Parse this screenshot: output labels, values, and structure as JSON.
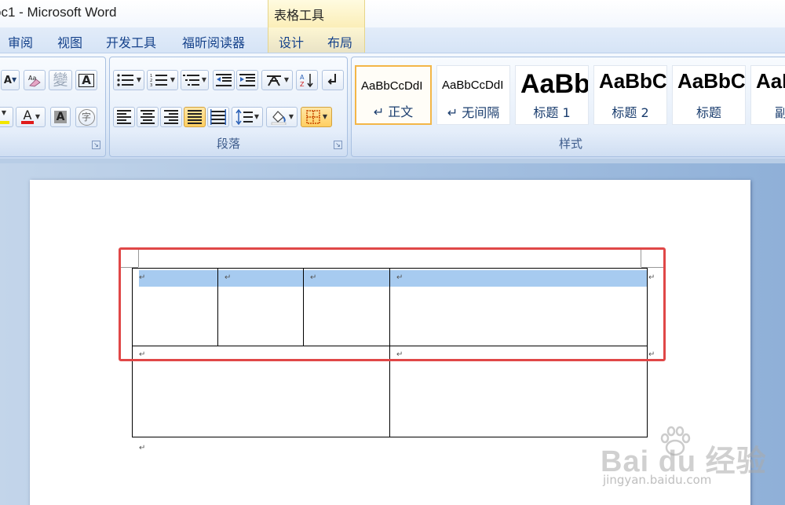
{
  "window": {
    "title": "oc1 - Microsoft Word",
    "context_tab_title": "表格工具"
  },
  "ribbon_tabs": {
    "review": "审阅",
    "view": "视图",
    "developer": "开发工具",
    "foxit_reader": "福昕阅读器",
    "design": "设计",
    "layout": "布局"
  },
  "groups": {
    "paragraph_label": "段落",
    "styles_label": "样式"
  },
  "font_group": {
    "font_color_letter": "A",
    "char_shading_letter": "A",
    "char_border_letter": "A",
    "phonetic_guide": "變",
    "enclose_char": "字"
  },
  "paragraph_group": {
    "sort_label": "A↓Z"
  },
  "styles": [
    {
      "sample": "AaBbCcDdI",
      "name": "↵ 正文",
      "size": "15px",
      "weight": "normal",
      "selected": true
    },
    {
      "sample": "AaBbCcDdI",
      "name": "↵ 无间隔",
      "size": "15px",
      "weight": "normal",
      "selected": false
    },
    {
      "sample": "AaBb",
      "name": "标题 1",
      "size": "34px",
      "weight": "bold",
      "selected": false
    },
    {
      "sample": "AaBbC",
      "name": "标题 2",
      "size": "26px",
      "weight": "bold",
      "selected": false
    },
    {
      "sample": "AaBbC",
      "name": "标题",
      "size": "26px",
      "weight": "bold",
      "selected": false
    },
    {
      "sample": "AaB",
      "name": "副标",
      "size": "26px",
      "weight": "bold",
      "selected": false
    }
  ],
  "document": {
    "cell_mark": "↵"
  },
  "watermark": {
    "text": "Bai  du 经验",
    "url": "jingyan.baidu.com"
  },
  "colors": {
    "ribbon_text": "#15428b",
    "highlight_row": "#a7cbf0",
    "annotation_red": "#e04747",
    "font_color_red": "#e01b1b",
    "highlight_yellow": "#f2e600"
  }
}
